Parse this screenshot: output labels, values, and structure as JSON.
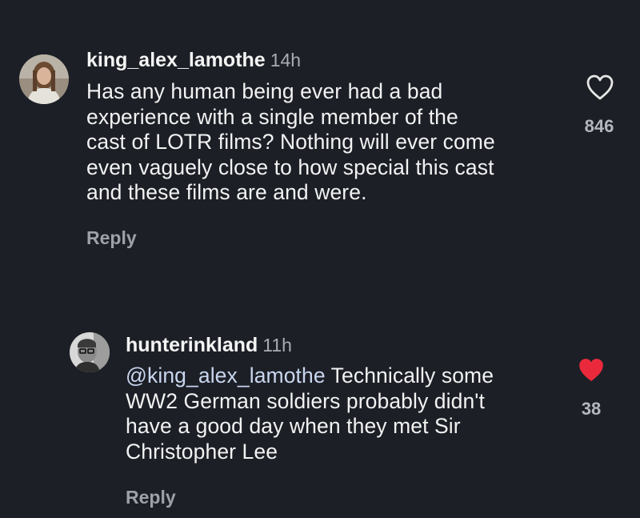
{
  "comments": [
    {
      "username": "king_alex_lamothe",
      "time": "14h",
      "lines": [
        "Has any human being ever had a bad",
        "experience with a single member of the",
        "cast of LOTR films? Nothing will ever come",
        "even vaguely close to how special this cast",
        "and these films are and were."
      ],
      "reply_label": "Reply",
      "likes": "846",
      "liked": false,
      "heart_icon": "heart-outline-icon"
    },
    {
      "username": "hunterinkland",
      "time": "11h",
      "mention": "@king_alex_lamothe",
      "lines": [
        " Technically some",
        "WW2 German soldiers probably didn't",
        "have a good day when they met Sir",
        "Christopher Lee"
      ],
      "reply_label": "Reply",
      "likes": "38",
      "liked": true,
      "heart_icon": "heart-filled-icon"
    }
  ],
  "colors": {
    "background": "#1c1f26",
    "text": "#f2f2f2",
    "muted": "#a9acb2",
    "heart_active": "#ea2a3c"
  }
}
